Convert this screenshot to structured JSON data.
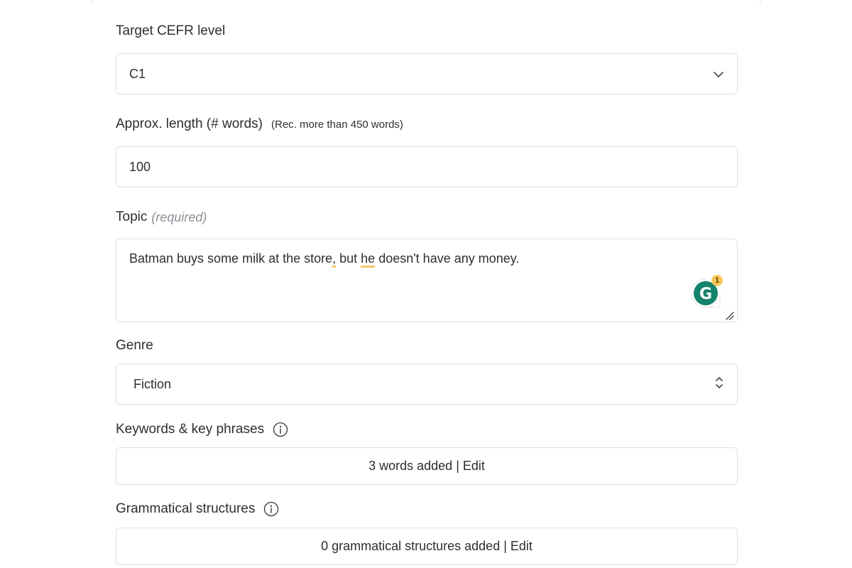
{
  "form": {
    "cefr": {
      "label": "Target CEFR level",
      "value": "C1",
      "icon": "chevron-down-icon"
    },
    "length": {
      "label": "Approx. length (# words)",
      "hint": "(Rec. more than 450 words)",
      "value": "100"
    },
    "topic": {
      "label": "Topic",
      "required": "(required)",
      "text_parts": [
        "Batman buys some milk at the store",
        ",",
        " but ",
        "he",
        " doesn't have any money."
      ],
      "grammarly_count": "1"
    },
    "genre": {
      "label": "Genre",
      "value": "Fiction",
      "icon": "chevron-up-down-icon"
    },
    "keywords": {
      "label": "Keywords & key phrases",
      "button": "3 words added | Edit",
      "icon": "info-icon"
    },
    "grammar": {
      "label": "Grammatical structures",
      "button": "0 grammatical structures added | Edit",
      "icon": "info-icon"
    }
  },
  "colors": {
    "border": "#dcdfe4",
    "grammarly_green": "#15836b",
    "grammarly_badge": "#f8c85a",
    "underline": "#f5c56b"
  }
}
